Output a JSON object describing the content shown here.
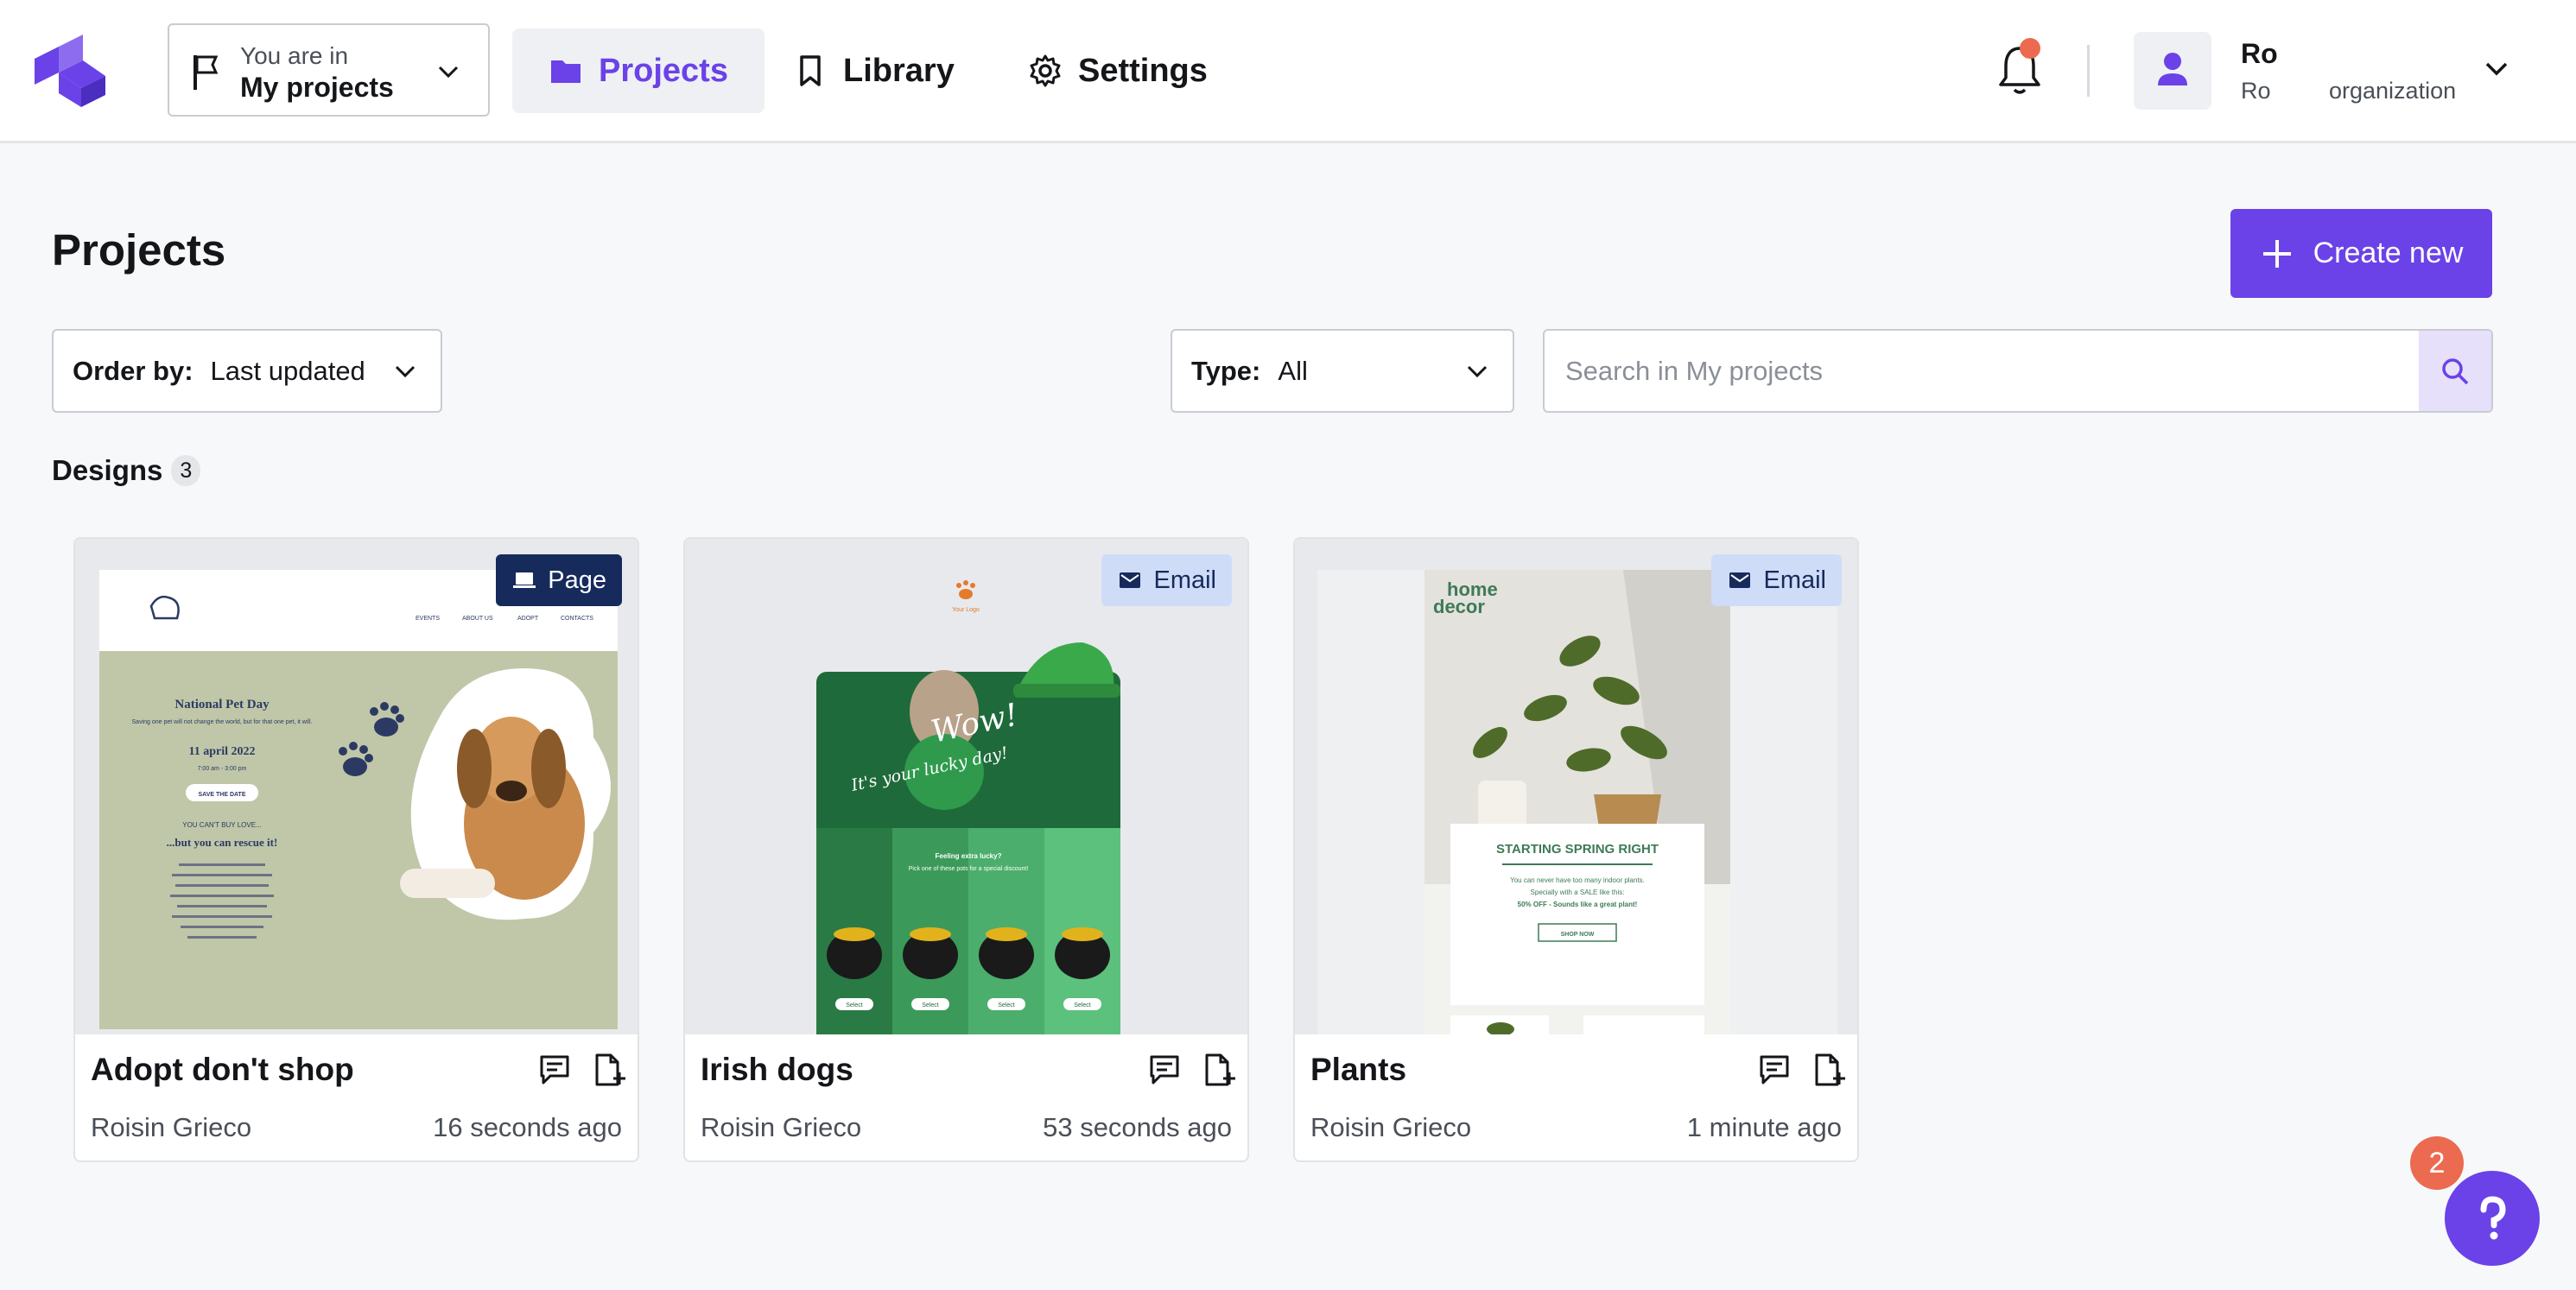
{
  "header": {
    "workspace_prefix": "You are in",
    "workspace_name": "My projects",
    "nav": [
      {
        "label": "Projects",
        "active": true,
        "icon": "folder-icon"
      },
      {
        "label": "Library",
        "active": false,
        "icon": "bookmark-icon"
      },
      {
        "label": "Settings",
        "active": false,
        "icon": "gear-icon"
      }
    ],
    "notification_indicator": true,
    "user": {
      "name": "Ro",
      "subtitle": "Ro",
      "organization": "organization"
    }
  },
  "page": {
    "title": "Projects",
    "create_label": "Create new"
  },
  "filters": {
    "order_label": "Order by:",
    "order_value": "Last updated",
    "type_label": "Type:",
    "type_value": "All",
    "search_placeholder": "Search in My projects"
  },
  "designs": {
    "label": "Designs",
    "count": "3",
    "items": [
      {
        "title": "Adopt don't shop",
        "type": "Page",
        "author": "Roisin Grieco",
        "updated": "16 seconds ago"
      },
      {
        "title": "Irish dogs",
        "type": "Email",
        "author": "Roisin Grieco",
        "updated": "53 seconds ago"
      },
      {
        "title": "Plants",
        "type": "Email",
        "author": "Roisin Grieco",
        "updated": "1 minute ago"
      }
    ]
  },
  "thumbnails": {
    "pet": {
      "nav": [
        "EVENTS",
        "ABOUT US",
        "ADOPT",
        "CONTACTS"
      ],
      "headline": "National Pet Day",
      "intro": "Saving one pet will not change the world, but for that one pet, it will.",
      "date": "11 april 2022",
      "time": "7:00 am - 3:00 pm",
      "cta": "SAVE THE DATE",
      "tagline_small": "YOU CAN'T BUY LOVE...",
      "tagline": "...but you can rescue it!"
    },
    "irish": {
      "logo": "Your Logo",
      "wow": "Wow!",
      "lucky": "It's your lucky day!",
      "extra": "Feeling extra lucky?",
      "pick": "Pick one of these pots for a special discount!",
      "select": "Select"
    },
    "plants": {
      "brand_1": "home",
      "brand_2": "decor",
      "headline": "STARTING SPRING RIGHT",
      "body": "You can never have too many indoor plants.",
      "body2": "Specially with a SALE like this:",
      "offer": "50% OFF - Sounds like a great plant!",
      "cta": "SHOP NOW"
    }
  },
  "help": {
    "badge": "2",
    "icon": "question-icon"
  },
  "colors": {
    "accent": "#6a42e8",
    "navy": "#172a5c",
    "alert": "#ec6a4f"
  }
}
